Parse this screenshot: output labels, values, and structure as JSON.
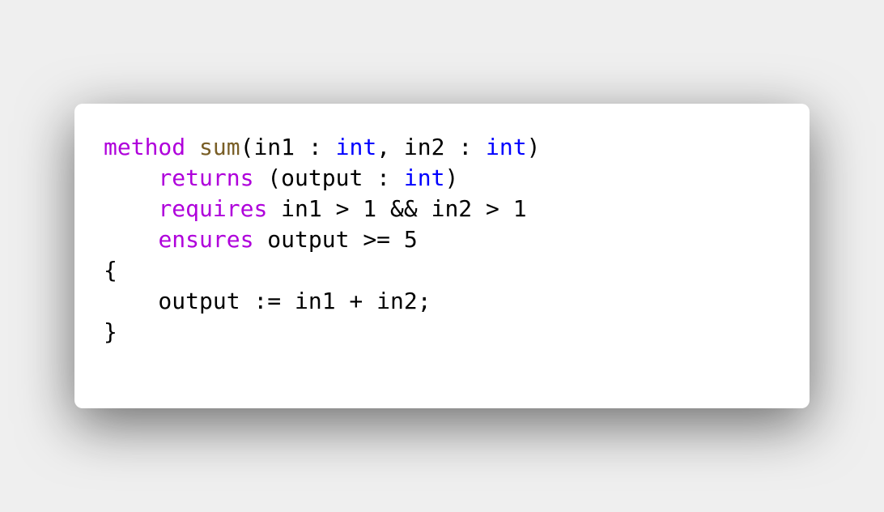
{
  "code": {
    "colors": {
      "background": "#efefef",
      "card": "#ffffff",
      "keyword": "#af00db",
      "function": "#795e26",
      "type": "#0000ff",
      "plain": "#000000"
    },
    "lines": [
      [
        {
          "text": "method",
          "kind": "keyword"
        },
        {
          "text": " ",
          "kind": "plain"
        },
        {
          "text": "sum",
          "kind": "function"
        },
        {
          "text": "(in1 : ",
          "kind": "plain"
        },
        {
          "text": "int",
          "kind": "type"
        },
        {
          "text": ", in2 : ",
          "kind": "plain"
        },
        {
          "text": "int",
          "kind": "type"
        },
        {
          "text": ")",
          "kind": "plain"
        }
      ],
      [
        {
          "text": "    ",
          "kind": "plain"
        },
        {
          "text": "returns",
          "kind": "keyword"
        },
        {
          "text": " (output : ",
          "kind": "plain"
        },
        {
          "text": "int",
          "kind": "type"
        },
        {
          "text": ")",
          "kind": "plain"
        }
      ],
      [
        {
          "text": "    ",
          "kind": "plain"
        },
        {
          "text": "requires",
          "kind": "keyword"
        },
        {
          "text": " in1 > 1 && in2 > 1",
          "kind": "plain"
        }
      ],
      [
        {
          "text": "    ",
          "kind": "plain"
        },
        {
          "text": "ensures",
          "kind": "keyword"
        },
        {
          "text": " output >= 5",
          "kind": "plain"
        }
      ],
      [
        {
          "text": "{",
          "kind": "plain"
        }
      ],
      [
        {
          "text": "    output := in1 + in2;",
          "kind": "plain"
        }
      ],
      [
        {
          "text": "}",
          "kind": "plain"
        }
      ]
    ]
  }
}
